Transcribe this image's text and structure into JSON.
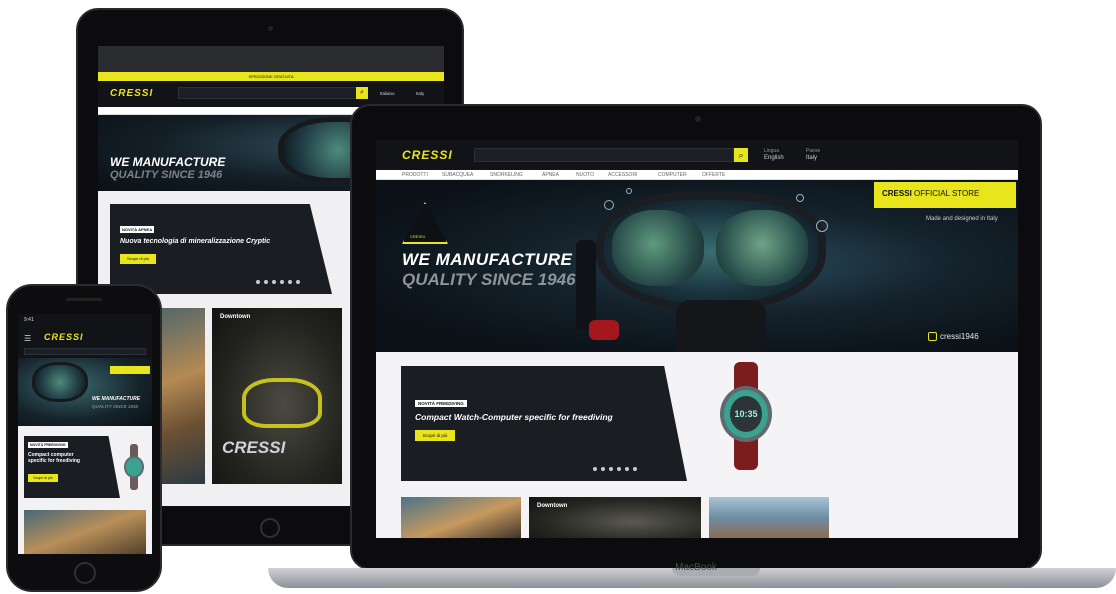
{
  "brand": {
    "logo": "CRESSI",
    "accent_color": "#e8e51c",
    "dark_color": "#111317"
  },
  "laptop": {
    "device_label": "MacBook",
    "header": {
      "lang_label": "Lingua",
      "lang_value": "English",
      "region_label": "Paese",
      "region_value": "Italy"
    },
    "nav": [
      "PRODOTTI",
      "SUBACQUEA",
      "SNORKELING",
      "APNEA",
      "NUOTO",
      "ACCESSORI",
      "COMPUTER",
      "OFFERTE"
    ],
    "hero": {
      "title": "WE MANUFACTURE",
      "subtitle": "QUALITY SINCE 1946",
      "badge_text": "CRESSI",
      "store_brand": "CRESSI",
      "store_label": "OFFICIAL STORE",
      "store_note": "Made and designed in Italy",
      "instagram": "cressi1946"
    },
    "promo": {
      "tag": "NOVITÀ FREEDIVING",
      "title": "Compact Watch-Computer specific for freediving",
      "button": "Scopri di più"
    },
    "watch_time": "10:35",
    "tiles": [
      "",
      "Downtown",
      ""
    ]
  },
  "tablet": {
    "banner": "SPEDIZIONE GRATUITA",
    "logo": "CRESSI",
    "lang_value": "Italiano",
    "region_value": "Italy",
    "hero_title": "WE MANUFACTURE",
    "hero_subtitle": "QUALITY SINCE 1946",
    "promo_tag": "NOVITÀ APNEA",
    "promo_title": "Nuova tecnologia di mineralizzazione Cryptic",
    "promo_button": "Scopri di più",
    "tile_label": "Downtown",
    "tile_logo": "CRESSI"
  },
  "phone": {
    "time": "9:41",
    "logo": "CRESSI",
    "hero_title": "WE MANUFACTURE",
    "hero_subtitle": "QUALITY SINCE 1946",
    "promo_tag": "NOVITÀ FREEDIVING",
    "promo_title": "Compact computer specific for freediving",
    "promo_button": "Scopri di più"
  }
}
